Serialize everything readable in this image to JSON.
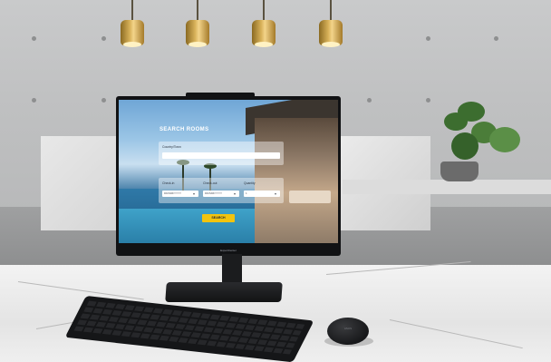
{
  "screen": {
    "title": "SEARCH ROOMS",
    "destination_label": "Country/Town",
    "destination_value": "",
    "checkin_label": "Check-in",
    "checkin_value": "DD/MM/YYYY",
    "checkout_label": "Check-out",
    "checkout_value": "DD/MM/YYYY",
    "quantity_label": "Quantity",
    "quantity_value": "1",
    "search_button": "SEARCH"
  },
  "monitor": {
    "chin_label": "ExpertCenter"
  },
  "mouse": {
    "logo": "ASUS"
  },
  "colors": {
    "search_button": "#f2c40f",
    "bezel": "#111214"
  }
}
